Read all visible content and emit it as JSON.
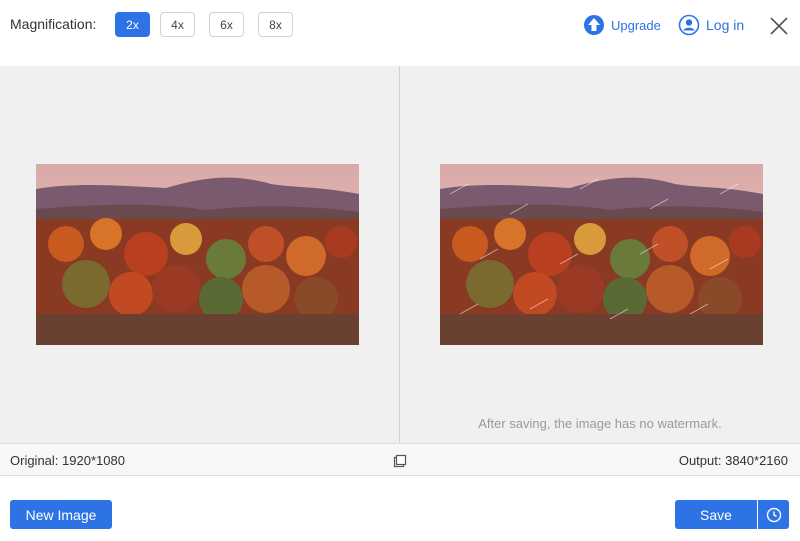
{
  "header": {
    "magnification_label": "Magnification:",
    "magnification_options": [
      "2x",
      "4x",
      "6x",
      "8x"
    ],
    "selected_magnification": "2x",
    "upgrade_label": "Upgrade",
    "login_label": "Log in"
  },
  "preview": {
    "watermark_note": "After saving, the image has no watermark."
  },
  "info": {
    "original": "Original: 1920*1080",
    "output": "Output: 3840*2160"
  },
  "footer": {
    "new_image_label": "New Image",
    "save_label": "Save"
  },
  "colors": {
    "accent": "#2d73e6",
    "panel_bg": "#f0f0f0"
  }
}
